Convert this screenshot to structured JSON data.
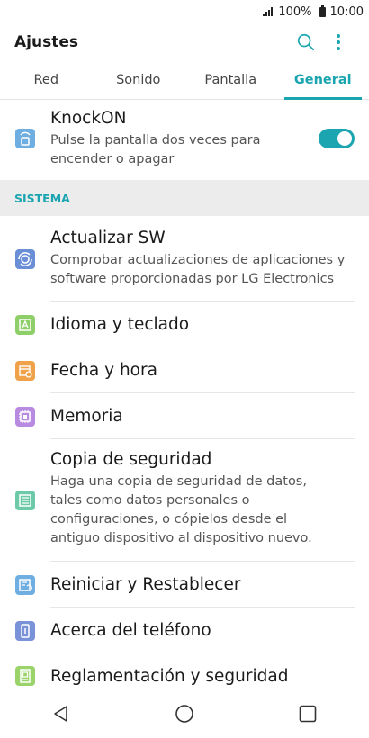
{
  "status_bar": {
    "battery": "100%",
    "time": "10:00"
  },
  "header": {
    "title": "Ajustes"
  },
  "tabs": [
    {
      "label": "Red"
    },
    {
      "label": "Sonido"
    },
    {
      "label": "Pantalla"
    },
    {
      "label": "General"
    }
  ],
  "knockon": {
    "title": "KnockON",
    "subtitle": "Pulse la pantalla dos veces para encender o apagar",
    "enabled": true
  },
  "section": {
    "label": "SISTEMA"
  },
  "items": [
    {
      "title": "Actualizar SW",
      "subtitle": "Comprobar actualizaciones de aplicaciones y software proporcionadas por LG Electronics",
      "color": "#6b8fd6"
    },
    {
      "title": "Idioma y teclado",
      "subtitle": "",
      "color": "#8fcf6a"
    },
    {
      "title": "Fecha y hora",
      "subtitle": "",
      "color": "#f0a24a"
    },
    {
      "title": "Memoria",
      "subtitle": "",
      "color": "#b98be0"
    },
    {
      "title": "Copia de seguridad",
      "subtitle": "Haga una copia de seguridad de datos, tales como datos personales o configuraciones, o cópielos desde el antiguo dispositivo al dispositivo nuevo.",
      "color": "#6ccaa8"
    },
    {
      "title": "Reiniciar y Restablecer",
      "subtitle": "",
      "color": "#6faee0"
    },
    {
      "title": "Acerca del teléfono",
      "subtitle": "",
      "color": "#7a93d8"
    },
    {
      "title": "Reglamentación y seguridad",
      "subtitle": "",
      "color": "#9ad36a"
    }
  ],
  "colors": {
    "accent": "#1aa5b0"
  }
}
